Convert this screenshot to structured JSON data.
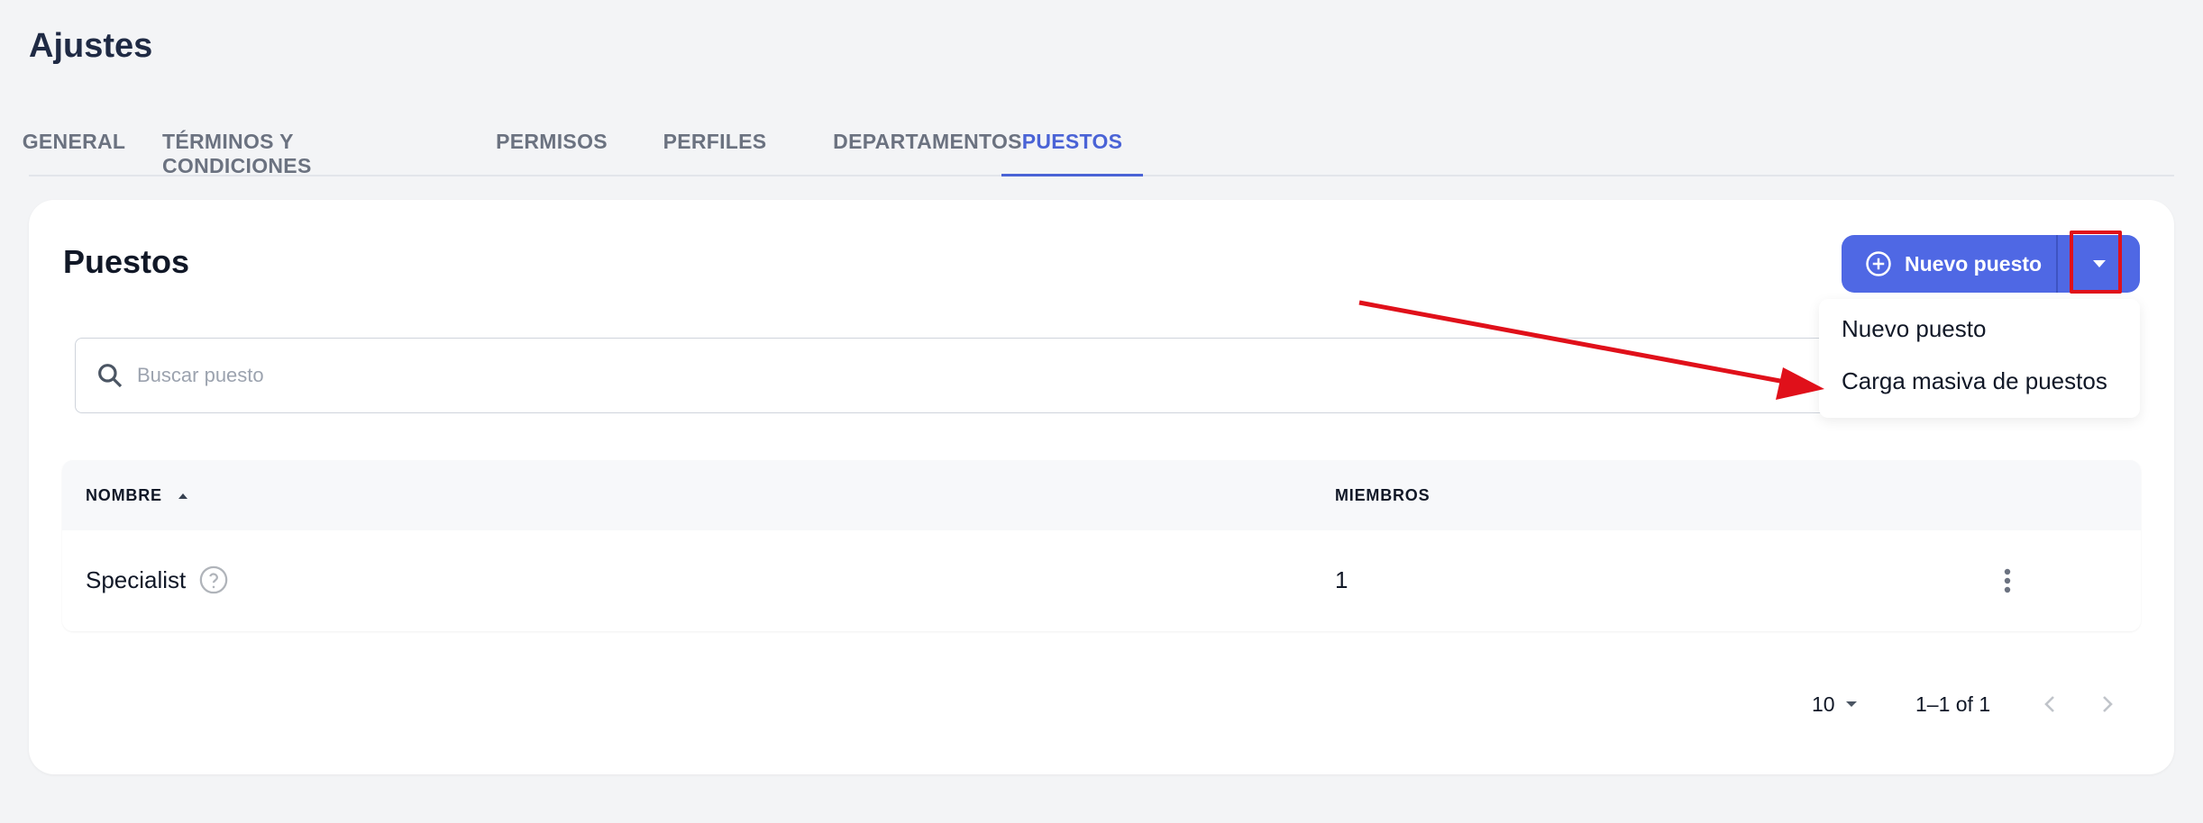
{
  "page": {
    "title": "Ajustes"
  },
  "tabs": [
    {
      "label": "GENERAL"
    },
    {
      "label": "TÉRMINOS Y CONDICIONES"
    },
    {
      "label": "PERMISOS"
    },
    {
      "label": "PERFILES"
    },
    {
      "label": "DEPARTAMENTOS"
    },
    {
      "label": "PUESTOS",
      "active": true
    }
  ],
  "card": {
    "title": "Puestos",
    "new_button_label": "Nuevo puesto",
    "search_placeholder": "Buscar puesto"
  },
  "menu": {
    "items": [
      {
        "label": "Nuevo puesto"
      },
      {
        "label": "Carga masiva de puestos"
      }
    ]
  },
  "table": {
    "columns": [
      {
        "label": "NOMBRE",
        "sorted": "asc"
      },
      {
        "label": "MIEMBROS"
      }
    ],
    "rows": [
      {
        "name": "Specialist",
        "members": "1"
      }
    ]
  },
  "pagination": {
    "rows_per_page": "10",
    "range": "1–1 of 1"
  },
  "colors": {
    "accent": "#4f68e4",
    "active_tab": "#4a63d6",
    "annotation": "#e0101a"
  },
  "icons": {
    "add": "plus-circle-icon",
    "dropdown": "caret-down-icon",
    "search": "search-icon",
    "sort": "sort-asc-icon",
    "help": "question-circle-icon",
    "row_actions": "kebab-menu-icon",
    "prev": "chevron-left-icon",
    "next": "chevron-right-icon"
  }
}
